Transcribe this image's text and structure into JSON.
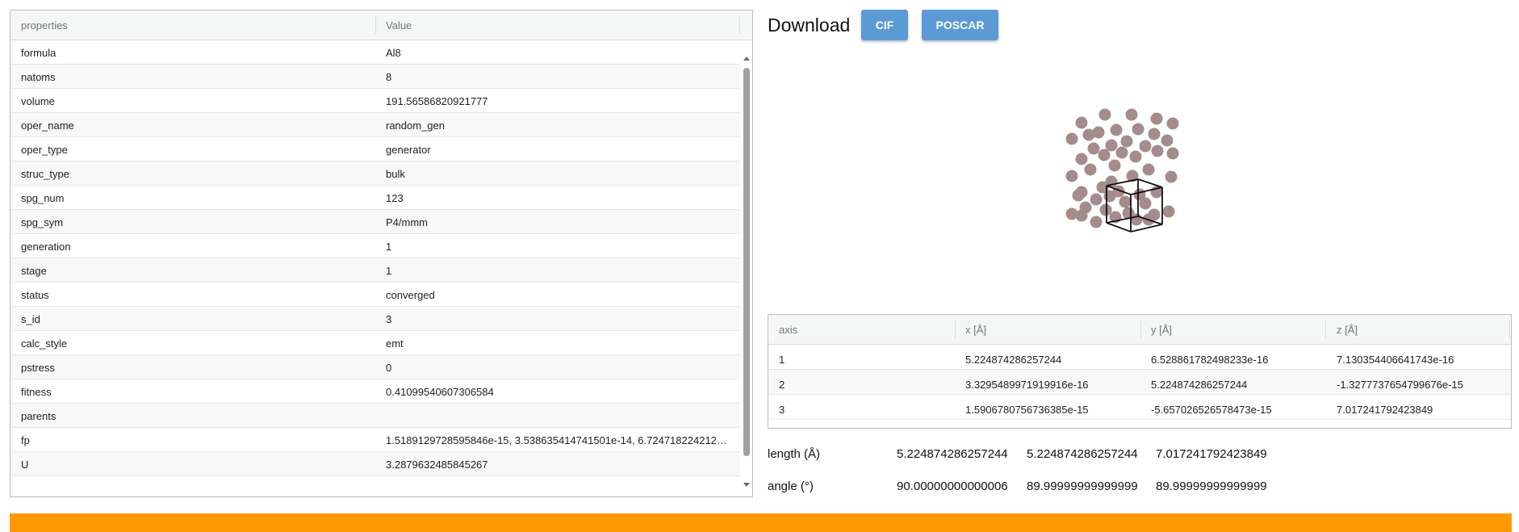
{
  "properties_table": {
    "header": {
      "property": "properties",
      "value": "Value"
    },
    "rows": [
      {
        "key": "formula",
        "value": "Al8"
      },
      {
        "key": "natoms",
        "value": "8"
      },
      {
        "key": "volume",
        "value": "191.56586820921777"
      },
      {
        "key": "oper_name",
        "value": "random_gen"
      },
      {
        "key": "oper_type",
        "value": "generator"
      },
      {
        "key": "struc_type",
        "value": "bulk"
      },
      {
        "key": "spg_num",
        "value": "123"
      },
      {
        "key": "spg_sym",
        "value": "P4/mmm"
      },
      {
        "key": "generation",
        "value": "1"
      },
      {
        "key": "stage",
        "value": "1"
      },
      {
        "key": "status",
        "value": "converged"
      },
      {
        "key": "s_id",
        "value": "3"
      },
      {
        "key": "calc_style",
        "value": "emt"
      },
      {
        "key": "pstress",
        "value": "0"
      },
      {
        "key": "fitness",
        "value": "0.41099540607306584"
      },
      {
        "key": "parents",
        "value": ""
      },
      {
        "key": "fp",
        "value": "1.5189129728595846e-15, 3.538635414741501e-14, 6.72471822421249..."
      },
      {
        "key": "U",
        "value": "3.2879632485845267"
      }
    ]
  },
  "download": {
    "label": "Download",
    "cif_label": "CIF",
    "poscar_label": "POSCAR",
    "button_color": "#5c9ad6"
  },
  "viewer": {
    "atom_color": "#a48c8c",
    "cell_edge_color": "#111111"
  },
  "lattice_table": {
    "headers": [
      "axis",
      "x [Å]",
      "y [Å]",
      "z [Å]"
    ],
    "rows": [
      [
        "1",
        "5.224874286257244",
        "6.528861782498233e-16",
        "7.130354406641743e-16"
      ],
      [
        "2",
        "3.3295489971919916e-16",
        "5.224874286257244",
        "-1.3277737654799676e-15"
      ],
      [
        "3",
        "1.5906780756736385e-15",
        "-5.657026526578473e-15",
        "7.017241792423849"
      ]
    ]
  },
  "length": {
    "label": "length (Å)",
    "values": [
      "5.224874286257244",
      "5.224874286257244",
      "7.017241792423849"
    ]
  },
  "angle": {
    "label": "angle (°)",
    "values": [
      "90.00000000000006",
      "89.99999999999999",
      "89.99999999999999"
    ]
  },
  "footer": {
    "color": "#ff9800"
  }
}
